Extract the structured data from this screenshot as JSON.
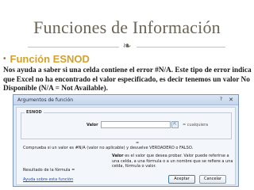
{
  "slide": {
    "title": "Funciones de Información",
    "ornament_icon": "❧",
    "bullet_icon": "•",
    "bullet_label": "Función ESNOD",
    "body_text": "Nos ayuda a saber si una celda contiene el error #N/A. Este tipo de error indica que Excel no ha encontrado el valor especificado, es decir tenemos un valor No Disponible (N/A = Not Available)."
  },
  "dialog": {
    "title": "Argumentos de función",
    "help_icon": "?",
    "close_icon": "✕",
    "function_name": "ESNOD",
    "argument_label": "Valor",
    "argument_value": "",
    "reference_button": "⇱",
    "argument_result": "=  cualquiera",
    "equals_result": "=",
    "description": "Comprueba si un valor es #N/A (valor no aplicable) y devuelve VERDADERO o FALSO.",
    "argument_desc_label": "Valor",
    "argument_desc_text": "es el valor que desea probar. Valor puede referirse a una celda, a una fórmula o a un nombre que se refiere a una celda, fórmula o valor.",
    "formula_result_label": "Resultado de la fórmula =",
    "help_link": "Ayuda sobre esta función",
    "ok_label": "Aceptar",
    "cancel_label": "Cancelar"
  }
}
